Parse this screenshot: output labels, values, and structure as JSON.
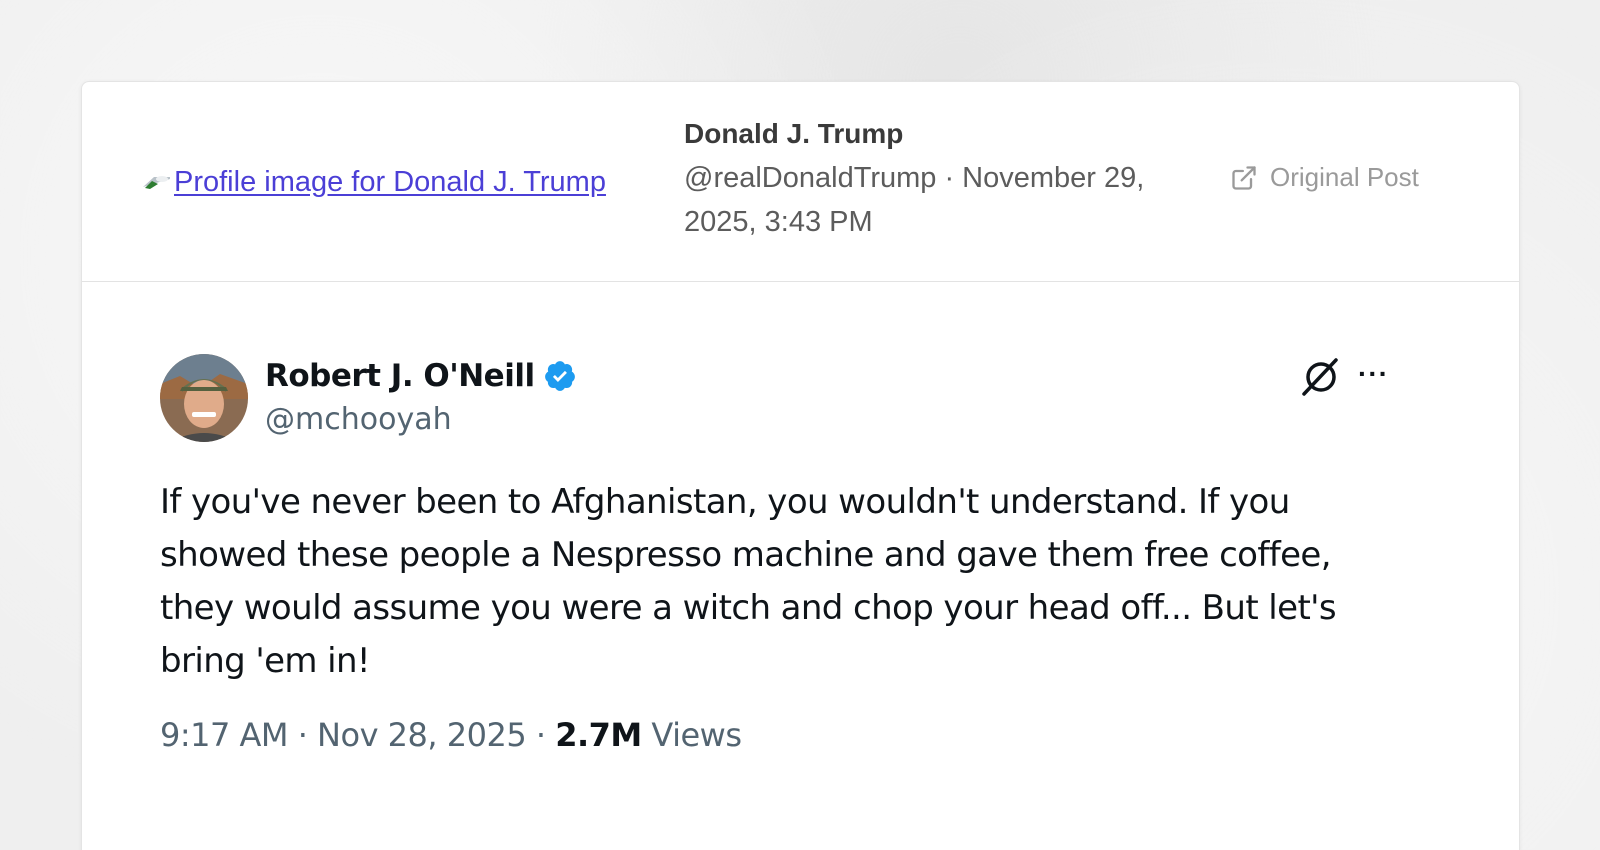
{
  "header": {
    "profile_image_alt": "Profile image for Donald J. Trump",
    "author_name": "Donald J. Trump",
    "author_meta": "@realDonaldTrump · November 29, 2025, 3:43 PM",
    "original_post_label": "Original Post",
    "original_post_icon": "external-link-icon"
  },
  "tweet": {
    "name": "Robert J. O'Neill",
    "handle": "@mchooyah",
    "verified": true,
    "verified_color": "#1d9bf0",
    "text": "If you've never been to Afghanistan, you wouldn't understand. If you showed these people a Nespresso machine and gave them free coffee, they would assume you were a witch and chop your head off... But let's bring 'em in!",
    "time_date": "9:17 AM · Nov 28, 2025 · ",
    "views_count": "2.7M",
    "views_label": " Views",
    "icons": [
      "grok-icon",
      "more-icon"
    ]
  },
  "colors": {
    "link": "#4b3fd6",
    "text_primary": "#0f1419",
    "text_secondary": "#536471"
  }
}
